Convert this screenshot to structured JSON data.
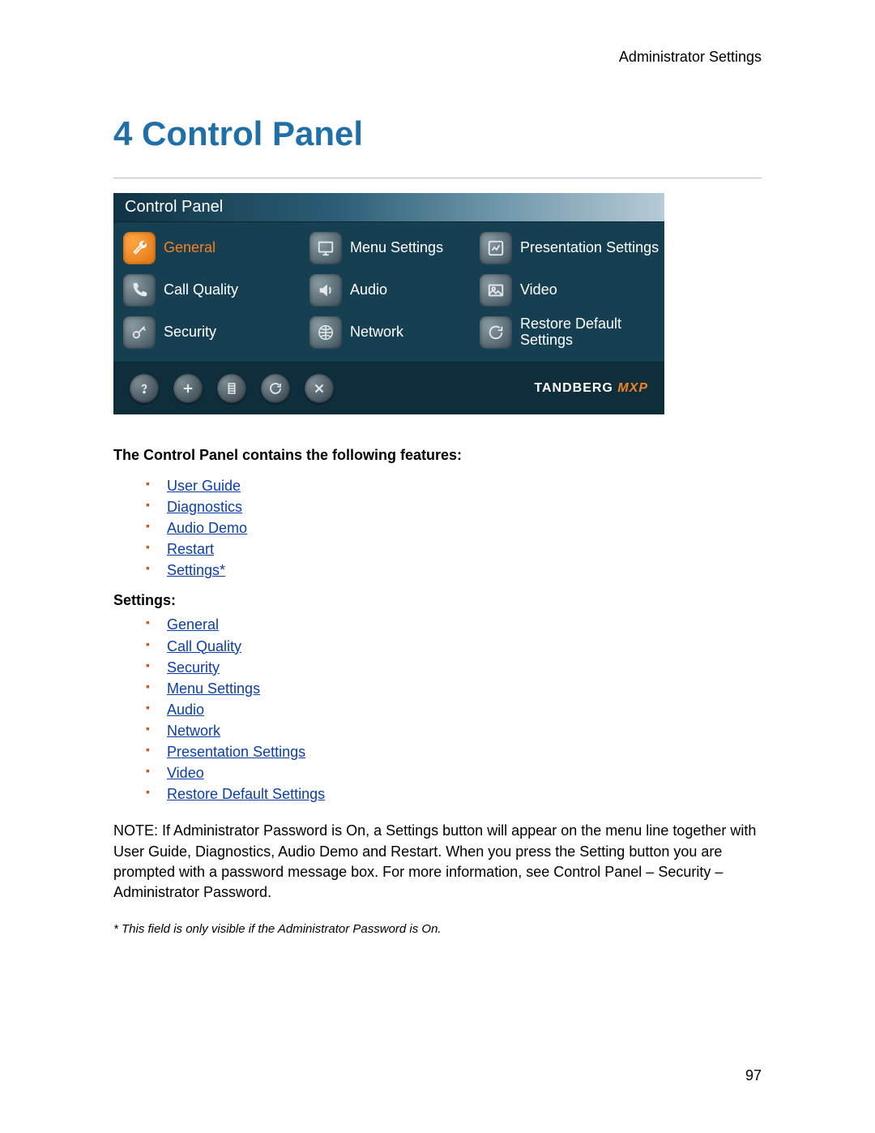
{
  "header": {
    "right": "Administrator Settings"
  },
  "section": {
    "title": "4 Control Panel"
  },
  "cp": {
    "title": "Control Panel",
    "items": [
      {
        "label": "General",
        "active": true,
        "icon": "wrench"
      },
      {
        "label": "Menu Settings",
        "active": false,
        "icon": "monitor"
      },
      {
        "label": "Presentation Settings",
        "active": false,
        "icon": "chart"
      },
      {
        "label": "Call Quality",
        "active": false,
        "icon": "phone"
      },
      {
        "label": "Audio",
        "active": false,
        "icon": "speaker"
      },
      {
        "label": "Video",
        "active": false,
        "icon": "picture"
      },
      {
        "label": "Security",
        "active": false,
        "icon": "key"
      },
      {
        "label": "Network",
        "active": false,
        "icon": "web"
      },
      {
        "label": "Restore Default Settings",
        "active": false,
        "icon": "refresh"
      }
    ],
    "toolbar": [
      "help",
      "add",
      "film",
      "reload",
      "close"
    ],
    "brand": {
      "name": "TANDBERG",
      "suffix": "MXP"
    }
  },
  "body": {
    "lead": "The Control Panel contains the following features:",
    "features": [
      "User Guide",
      "Diagnostics",
      "Audio Demo",
      "Restart",
      "Settings*"
    ],
    "settings_label": "Settings:",
    "settings": [
      "General",
      "Call Quality",
      "Security",
      "Menu Settings",
      "Audio",
      "Network",
      "Presentation Settings",
      "Video",
      "Restore Default Settings"
    ],
    "note": "NOTE: If Administrator Password is On, a Settings button will appear on the menu line together with User Guide, Diagnostics, Audio Demo and Restart. When you press the Setting button you are prompted with a password message box. For more information, see Control Panel – Security – Administrator Password.",
    "footnote": "* This field is only visible if the Administrator Password is On."
  },
  "page_number": "97"
}
